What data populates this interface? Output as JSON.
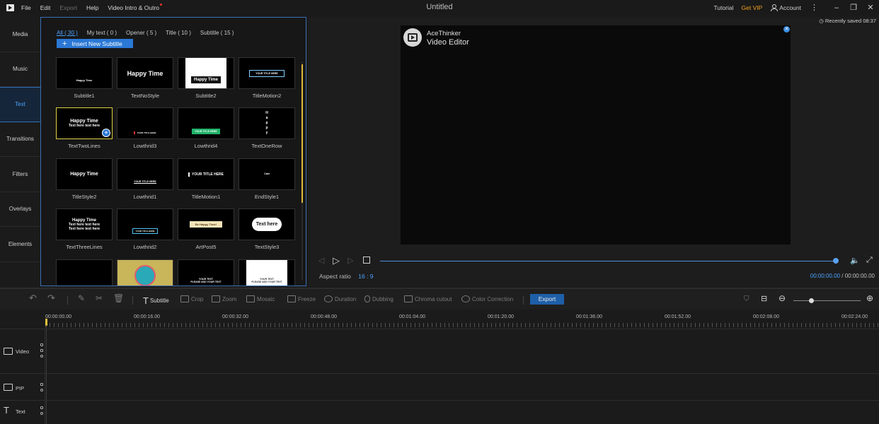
{
  "menu": {
    "file": "File",
    "edit": "Edit",
    "export": "Export",
    "help": "Help",
    "intro_outro": "Video Intro & Outro"
  },
  "window": {
    "title": "Untitled"
  },
  "header_right": {
    "tutorial": "Tutorial",
    "vip": "Get VIP",
    "account": "Account"
  },
  "sidebar": {
    "items": [
      {
        "label": "Media"
      },
      {
        "label": "Music"
      },
      {
        "label": "Text"
      },
      {
        "label": "Transitions"
      },
      {
        "label": "Filters"
      },
      {
        "label": "Overlays"
      },
      {
        "label": "Elements"
      }
    ]
  },
  "library": {
    "tabs": [
      {
        "label": "All ( 30 )"
      },
      {
        "label": "My text ( 0 )"
      },
      {
        "label": "Opener ( 5 )"
      },
      {
        "label": "Title ( 10 )"
      },
      {
        "label": "Subtitle ( 15 )"
      }
    ],
    "insert_label": "Insert New Subtitle",
    "tiles": [
      {
        "label": "Subtitle1",
        "t1": "Happy Time"
      },
      {
        "label": "TextNoStyle",
        "t1": "Happy Time"
      },
      {
        "label": "Subtitle2",
        "t1": "Happy Time"
      },
      {
        "label": "TitleMotion2",
        "t1": "YOUR TITLE HERE"
      },
      {
        "label": "TextTwoLines",
        "t1": "Happy Time",
        "t2": "Text here text here"
      },
      {
        "label": "Lowthrid3",
        "t1": "YOUR TITLE HERE"
      },
      {
        "label": "Lowthrid4",
        "t1": "YOUR TITLE HERE"
      },
      {
        "label": "TextOneRow",
        "t1": "H a p p y"
      },
      {
        "label": "TitleStyle2",
        "t1": "Happy Time"
      },
      {
        "label": "Lowthrid1",
        "t1": "YOUR TITLE HERE"
      },
      {
        "label": "TitleMotion1",
        "t1": "YOUR TITLE HERE"
      },
      {
        "label": "EndStyle1",
        "t1": "Cast"
      },
      {
        "label": "TextThreeLines",
        "t1": "Happy Time",
        "t2": "Text here text here",
        "t3": "Text here text here"
      },
      {
        "label": "Lowthrid2",
        "t1": "YOUR TITLE HERE"
      },
      {
        "label": "ArtPost5",
        "t1": "Be Happy Time!"
      },
      {
        "label": "TextStyle3",
        "t1": "Text here"
      },
      {
        "label": "",
        "t1": ""
      },
      {
        "label": "",
        "t1": ""
      },
      {
        "label": "",
        "t1": "YOUR TEXT",
        "t2": "PLEASE ADD YOUR TEXT"
      },
      {
        "label": "",
        "t1": "YOUR TEXT",
        "t2": "PLEASE ADD YOUR TEXT"
      }
    ]
  },
  "preview": {
    "saved": "Recently saved 08:37",
    "watermark_brand": "AceThinker",
    "watermark_product": "Video Editor",
    "aspect_label": "Aspect ratio",
    "aspect_value": "16 : 9",
    "time_current": "00:00:00.00",
    "time_sep": "/",
    "time_total": "00:00:00.00"
  },
  "toolbar": {
    "subtitle": "Subtitle",
    "crop": "Crop",
    "zoom": "Zoom",
    "mosaic": "Mosaic",
    "freeze": "Freeze",
    "duration": "Duration",
    "dubbing": "Dubbing",
    "chroma": "Chroma cutout",
    "color": "Color Correction",
    "export": "Export"
  },
  "timeline": {
    "ruler": [
      "00:00:00.00",
      "00:00:16.00",
      "00:00:32.00",
      "00:00:48.00",
      "00:01:04.00",
      "00:01:20.00",
      "00:01:36.00",
      "00:01:52.00",
      "00:02:08.00",
      "00:02:24.00"
    ],
    "tracks": [
      {
        "name": "Video"
      },
      {
        "name": "PIP"
      },
      {
        "name": "Text"
      }
    ]
  },
  "colors": {
    "accent": "#2b78d6",
    "vip": "#f0a020",
    "playhead": "#e2c23b"
  }
}
